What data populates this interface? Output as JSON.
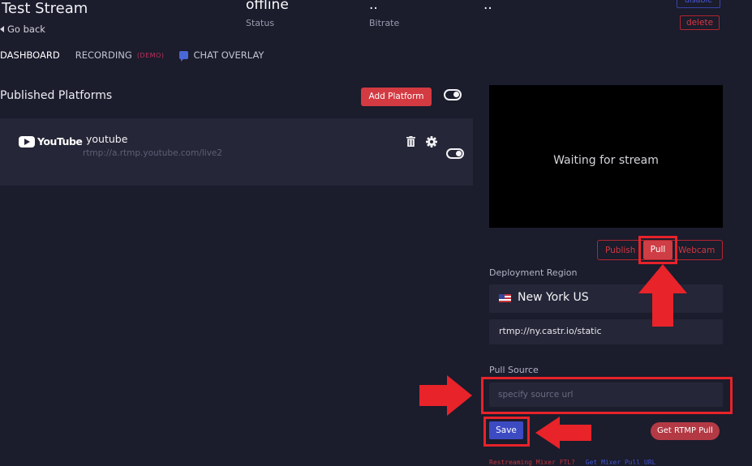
{
  "header": {
    "title": "Test Stream",
    "go_back": "Go back",
    "status_value": "offline",
    "status_label": "Status",
    "bitrate_value": "..",
    "bitrate_label": "Bitrate",
    "third_value": "..",
    "disable_label": "disable",
    "delete_label": "delete"
  },
  "tabs": [
    {
      "label": "DASHBOARD",
      "active": true
    },
    {
      "label": "RECORDING",
      "badge": "(DEMO)"
    },
    {
      "label": "CHAT OVERLAY"
    }
  ],
  "platforms": {
    "title": "Published Platforms",
    "add_button": "Add Platform",
    "items": [
      {
        "logo_text": "YouTube",
        "name": "youtube",
        "url": "rtmp://a.rtmp.youtube.com/live2"
      }
    ]
  },
  "preview": {
    "waiting_text": "Waiting for stream"
  },
  "modes": {
    "publish": "Publish",
    "pull": "Pull",
    "webcam": "Webcam",
    "selected": "Pull"
  },
  "deployment": {
    "label": "Deployment Region",
    "region": "New York US",
    "rtmp": "rtmp://ny.castr.io/static"
  },
  "pull_source": {
    "label": "Pull Source",
    "placeholder": "specify source url",
    "save": "Save",
    "get_rtmp_pull": "Get RTMP Pull"
  },
  "footer": {
    "left": "Restreaming Mixer FTL?",
    "right": "Get Mixer Pull URL"
  },
  "colors": {
    "background": "#1b1c2c",
    "card": "#252637",
    "accent_red": "#d33a42",
    "accent_blue": "#3c4bc2",
    "highlight": "#e8232a"
  }
}
